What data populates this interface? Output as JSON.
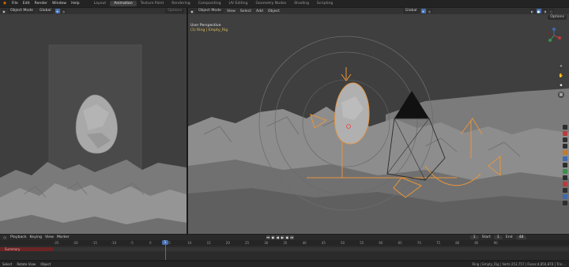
{
  "topbar": {
    "menus": [
      "File",
      "Edit",
      "Render",
      "Window",
      "Help"
    ],
    "workspaces": [
      "Layout",
      "Modeling",
      "Sculpting",
      "UV Editing",
      "Texture Paint",
      "Shading",
      "Animation",
      "Rendering",
      "Compositing",
      "Geometry Nodes",
      "Scripting"
    ],
    "active_workspace": "Animation"
  },
  "viewport_left": {
    "mode": "Object Mode",
    "orientation": "Global",
    "options": "Options"
  },
  "viewport_right": {
    "mode": "Object Mode",
    "menus": [
      "View",
      "Select",
      "Add",
      "Object"
    ],
    "orientation": "Global",
    "options": "Options",
    "perspective": "User Perspective",
    "object": "(1) Ring | Empty_Rig"
  },
  "timeline": {
    "menus": [
      "Playback",
      "Keying",
      "View",
      "Marker"
    ],
    "current_frame": "1",
    "start_label": "Start",
    "start": "1",
    "end_label": "End",
    "end": "48",
    "ticks": [
      "-25",
      "-20",
      "-15",
      "-10",
      "-5",
      "0",
      "5",
      "10",
      "15",
      "20",
      "25",
      "30",
      "35",
      "40",
      "45",
      "50",
      "55",
      "60",
      "65",
      "70",
      "75",
      "80",
      "85",
      "90"
    ],
    "playhead": "1",
    "summary": "Summary"
  },
  "statusbar": {
    "items": [
      "Select",
      "Rotate View",
      "Object"
    ],
    "right": "Ring | Empty_Rig | Verts:252,757 | Faces:4,850,870 | Tris:..."
  },
  "colors": {
    "accent": "#4772b3",
    "gizmo_orange": "#e8953a",
    "object_name": "#e2c15a",
    "summary": "#6b2424"
  }
}
